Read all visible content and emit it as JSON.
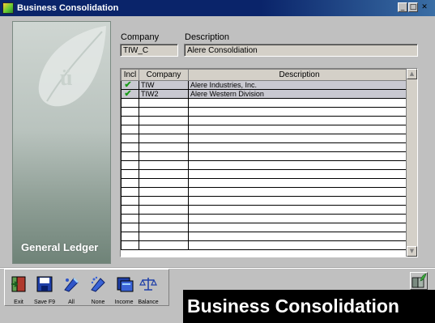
{
  "window": {
    "title": "Business Consolidation"
  },
  "sidebar": {
    "product_label": "General Ledger"
  },
  "header": {
    "company_label": "Company",
    "description_label": "Description",
    "company_value": "TIW_C",
    "description_value": "Alere Consoldiation"
  },
  "grid": {
    "columns": [
      "Incl",
      "Company",
      "Description"
    ],
    "rows": [
      {
        "included": true,
        "company": "TIW",
        "description": "Alere Industries, Inc."
      },
      {
        "included": true,
        "company": "TIW2",
        "description": "Alere Western Division"
      }
    ],
    "empty_rows": 17
  },
  "toolbar": {
    "buttons": [
      {
        "label": "Exit",
        "icon": "exit-door-icon"
      },
      {
        "label": "Save F9",
        "icon": "floppy-disk-icon"
      },
      {
        "label": "All",
        "icon": "select-all-icon"
      },
      {
        "label": "None",
        "icon": "select-none-icon"
      },
      {
        "label": "Income",
        "icon": "income-icon"
      },
      {
        "label": "Balance",
        "icon": "balance-scale-icon"
      }
    ]
  },
  "banner": {
    "text": "Business Consolidation"
  },
  "colors": {
    "titlebar": "#0a246a",
    "check": "#1a9a1a",
    "selected_row": "#c9c9d1"
  }
}
